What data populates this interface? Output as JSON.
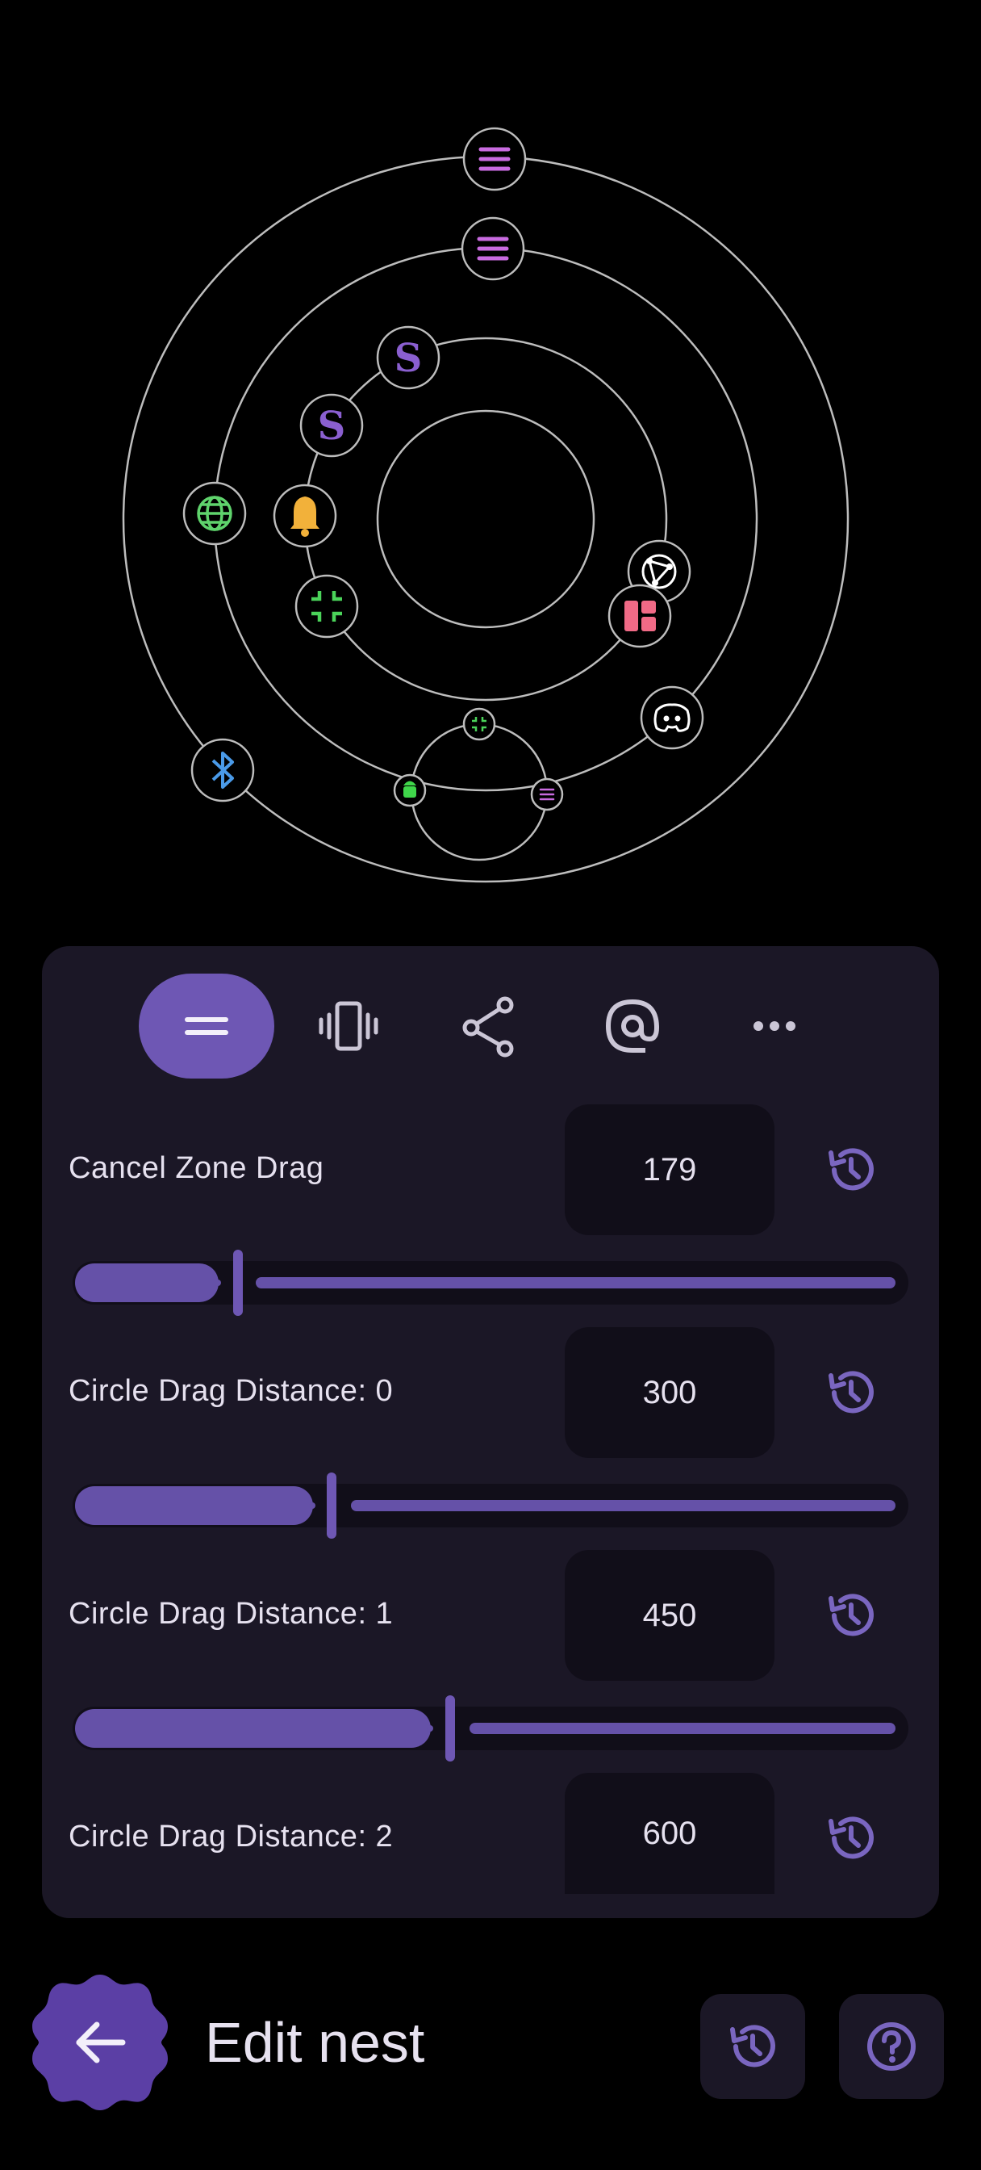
{
  "orbit": {
    "nodes": [
      {
        "name": "menu-lines-icon-outer",
        "icon": "menu-lines",
        "color": "#c96be0"
      },
      {
        "name": "menu-lines-icon",
        "icon": "menu-lines",
        "color": "#c96be0"
      },
      {
        "name": "dragon-app-icon",
        "icon": "dragon-logo",
        "color": "#8a5fd0"
      },
      {
        "name": "dragon-app-icon-2",
        "icon": "dragon-logo",
        "color": "#8a5fd0"
      },
      {
        "name": "globe-icon",
        "icon": "globe",
        "color": "#5fd36c"
      },
      {
        "name": "bell-icon",
        "icon": "bell",
        "color": "#f2b13a"
      },
      {
        "name": "shrink-icon",
        "icon": "fullscreen-exit",
        "color": "#4bd35a"
      },
      {
        "name": "share-network-icon",
        "icon": "network",
        "color": "#ffffff"
      },
      {
        "name": "widget-icon",
        "icon": "widget",
        "color": "#f06a86"
      },
      {
        "name": "discord-icon",
        "icon": "discord",
        "color": "#ffffff"
      },
      {
        "name": "bluetooth-icon",
        "icon": "bluetooth",
        "color": "#4a9ae8"
      },
      {
        "name": "android-icon",
        "icon": "android",
        "color": "#3fd64a"
      },
      {
        "name": "small-shrink-icon",
        "icon": "fullscreen-exit",
        "color": "#4bd35a"
      },
      {
        "name": "small-menu-icon",
        "icon": "menu-lines",
        "color": "#c96be0"
      }
    ]
  },
  "tabs": [
    {
      "name": "tab-menu",
      "icon": "menu-icon",
      "active": true
    },
    {
      "name": "tab-vibration",
      "icon": "vibration-icon",
      "active": false
    },
    {
      "name": "tab-share",
      "icon": "share-icon",
      "active": false
    },
    {
      "name": "tab-target",
      "icon": "at-target-icon",
      "active": false
    },
    {
      "name": "tab-more",
      "icon": "more-horizontal-icon",
      "active": false
    }
  ],
  "settings": [
    {
      "label": "Cancel Zone Drag",
      "value": "179",
      "fraction": 0.2
    },
    {
      "label": "Circle Drag Distance: 0",
      "value": "300",
      "fraction": 0.31
    },
    {
      "label": "Circle Drag Distance: 1",
      "value": "450",
      "fraction": 0.45
    },
    {
      "label": "Circle Drag Distance: 2",
      "value": "600",
      "fraction": null
    }
  ],
  "bottom": {
    "title": "Edit nest",
    "back_icon": "arrow-left-icon",
    "history_icon": "history-icon",
    "help_icon": "help-icon"
  },
  "colors": {
    "accent": "#6e57b4",
    "panel": "#1b1726",
    "field": "#110e19",
    "orbit_line": "#bdbdbd"
  }
}
